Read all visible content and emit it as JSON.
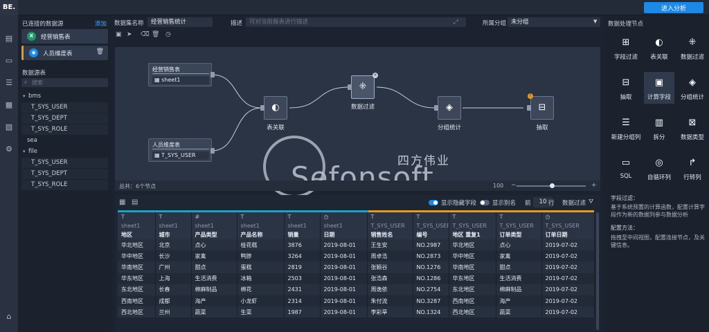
{
  "app": {
    "logo": "BE.",
    "enter_analysis": "进入分析"
  },
  "left_panel": {
    "connected_title": "已连接的数据源",
    "add_label": "添加",
    "connected": [
      {
        "name": "经营销售表",
        "icon": "excel-icon",
        "color": "#1d9a6c"
      },
      {
        "name": "人员维度表",
        "icon": "db-icon",
        "color": "#1e88e5"
      }
    ],
    "tables_title": "数据源表",
    "search_placeholder": "搜索",
    "tree": [
      {
        "label": "bms",
        "type": "group"
      },
      {
        "label": "T_SYS_USER",
        "type": "child"
      },
      {
        "label": "T_SYS_DEPT",
        "type": "child"
      },
      {
        "label": "T_SYS_ROLE",
        "type": "child"
      },
      {
        "label": "sea",
        "type": "leaf"
      },
      {
        "label": "file",
        "type": "group"
      },
      {
        "label": "T_SYS_USER",
        "type": "child"
      },
      {
        "label": "T_SYS_DEPT",
        "type": "child"
      },
      {
        "label": "T_SYS_ROLE",
        "type": "child"
      }
    ]
  },
  "header": {
    "dataset_label": "数据集名称",
    "dataset_value": "经营销售统计",
    "desc_label": "描述",
    "desc_placeholder": "可对当前报表进行描述",
    "group_label": "所属分组",
    "group_value": "未分组"
  },
  "canvas": {
    "source_nodes": [
      {
        "title": "经营销售表",
        "sheet": "sheet1"
      },
      {
        "title": "人员维度表",
        "sheet": "T_SYS_USER"
      }
    ],
    "process_nodes": [
      {
        "label": "表关联",
        "icon": "join-icon"
      },
      {
        "label": "数据过滤",
        "icon": "filter-icon"
      },
      {
        "label": "分组统计",
        "icon": "group-stats-icon"
      },
      {
        "label": "抽取",
        "icon": "extract-icon"
      }
    ],
    "total": "总共：6个节点",
    "zoom": "100",
    "watermark": "Sefonsoft",
    "watermark_cn": "四方伟业"
  },
  "grid": {
    "show_hidden_label": "显示隐藏字段",
    "show_alias_label": "显示别名",
    "front_label": "前",
    "rows_count": "10",
    "rows_label": "行",
    "data_filter_label": "数据过滤",
    "accent_colors": {
      "blue": "#1aa3c4",
      "orange": "#e69a1e"
    },
    "columns": [
      {
        "type": "T",
        "src": "sheet1",
        "name": "地区"
      },
      {
        "type": "T",
        "src": "sheet1",
        "name": "城市"
      },
      {
        "type": "#",
        "src": "sheet1",
        "name": "产品类型"
      },
      {
        "type": "T",
        "src": "sheet1",
        "name": "产品名称"
      },
      {
        "type": "T",
        "src": "sheet1",
        "name": "销量"
      },
      {
        "type": "◷",
        "src": "sheet1",
        "name": "日期"
      },
      {
        "type": "T",
        "src": "T_SYS_USER",
        "name": "销售姓名"
      },
      {
        "type": "T",
        "src": "T_SYS_USER",
        "name": "编号"
      },
      {
        "type": "T",
        "src": "T_SYS_USER",
        "name": "地区 重复1"
      },
      {
        "type": "T",
        "src": "T_SYS_USER",
        "name": "订单类型"
      },
      {
        "type": "◷",
        "src": "T_SYS_USER",
        "name": "订单日期"
      }
    ],
    "rows": [
      [
        "华北地区",
        "北京",
        "点心",
        "桂花糕",
        "3876",
        "2019-08-01",
        "王生安",
        "NO.2987",
        "华北地区",
        "点心",
        "2019-07-02"
      ],
      [
        "华中地区",
        "长沙",
        "家禽",
        "鸭脖",
        "3264",
        "2019-08-01",
        "周卓浩",
        "NO.2873",
        "华中地区",
        "家禽",
        "2019-07-02"
      ],
      [
        "华南地区",
        "广州",
        "甜点",
        "蛋糕",
        "2819",
        "2019-08-01",
        "张颖谷",
        "NO.1276",
        "华南地区",
        "甜点",
        "2019-07-02"
      ],
      [
        "华东地区",
        "上海",
        "生活消费",
        "冰箱",
        "2503",
        "2019-08-01",
        "张浩森",
        "NO.1286",
        "华东地区",
        "生活消费",
        "2019-07-02"
      ],
      [
        "东北地区",
        "长春",
        "棉麻制品",
        "棉花",
        "2431",
        "2019-08-01",
        "周逸依",
        "NO.2754",
        "东北地区",
        "棉麻制品",
        "2019-07-02"
      ],
      [
        "西南地区",
        "成都",
        "海产",
        "小龙虾",
        "2314",
        "2019-08-01",
        "朱付流",
        "NO.3287",
        "西南地区",
        "海产",
        "2019-07-02"
      ],
      [
        "西北地区",
        "兰州",
        "蔬菜",
        "生菜",
        "1987",
        "2019-08-01",
        "李彩旱",
        "NO.1324",
        "西北地区",
        "蔬菜",
        "2019-07-02"
      ]
    ]
  },
  "right_panel": {
    "title": "数据处理节点",
    "nodes": [
      {
        "label": "字段过滤",
        "icon": "field-filter-icon"
      },
      {
        "label": "表关联",
        "icon": "join-icon"
      },
      {
        "label": "数据过滤",
        "icon": "filter-icon"
      },
      {
        "label": "抽取",
        "icon": "extract-icon"
      },
      {
        "label": "计算字段",
        "icon": "calc-field-icon"
      },
      {
        "label": "分组统计",
        "icon": "group-stats-icon"
      },
      {
        "label": "新建分组列",
        "icon": "new-group-column-icon"
      },
      {
        "label": "拆分",
        "icon": "split-icon"
      },
      {
        "label": "数据类型",
        "icon": "data-type-icon"
      },
      {
        "label": "SQL",
        "icon": "sql-icon"
      },
      {
        "label": "自循环列",
        "icon": "self-loop-icon"
      },
      {
        "label": "行转列",
        "icon": "row-to-column-icon"
      }
    ],
    "desc_title": "字段过滤：",
    "desc_text": "基于系统预置的计算函数，配置计算字段作为新的数据列参与数据分析",
    "config_title": "配置方法：",
    "config_text": "拖拽至中间视图，配置连接节点，及关键信息。"
  }
}
